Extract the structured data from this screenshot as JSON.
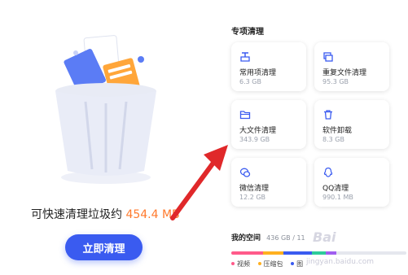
{
  "summary": {
    "prefix": "可快速清理垃圾约",
    "size": "454.4 MB"
  },
  "clean_button": {
    "label": "立即清理"
  },
  "special_cleanup": {
    "title": "专项清理",
    "cards": [
      {
        "label": "常用项清理",
        "value": "6.3 GB",
        "icon": "broom-icon"
      },
      {
        "label": "重复文件清理",
        "value": "95.3 GB",
        "icon": "duplicate-files-icon"
      },
      {
        "label": "大文件清理",
        "value": "343.9 GB",
        "icon": "folder-icon"
      },
      {
        "label": "软件卸载",
        "value": "8.3 GB",
        "icon": "trash-icon"
      },
      {
        "label": "微信清理",
        "value": "12.2 GB",
        "icon": "wechat-icon"
      },
      {
        "label": "QQ清理",
        "value": "990.1 MB",
        "icon": "qq-icon"
      }
    ]
  },
  "storage": {
    "title": "我的空间",
    "usage": "436 GB / 11",
    "legend": [
      {
        "label": "视频",
        "color": "#ff5a8a"
      },
      {
        "label": "压缩包",
        "color": "#ffb020"
      },
      {
        "label": "图",
        "color": "#3a5bf0"
      }
    ],
    "segments": [
      {
        "color": "#ff5a8a",
        "fraction": 0.18
      },
      {
        "color": "#ffb020",
        "fraction": 0.12
      },
      {
        "color": "#3a5bf0",
        "fraction": 0.16
      },
      {
        "color": "#2ecc9a",
        "fraction": 0.08
      },
      {
        "color": "#a05ef0",
        "fraction": 0.06
      }
    ]
  },
  "watermark": {
    "text": "Bai",
    "subtext": "jingyan.baidu.com"
  },
  "colors": {
    "accent": "#3a5bf0",
    "size_highlight": "#ff7a2d",
    "arrow": "#e0282a"
  }
}
